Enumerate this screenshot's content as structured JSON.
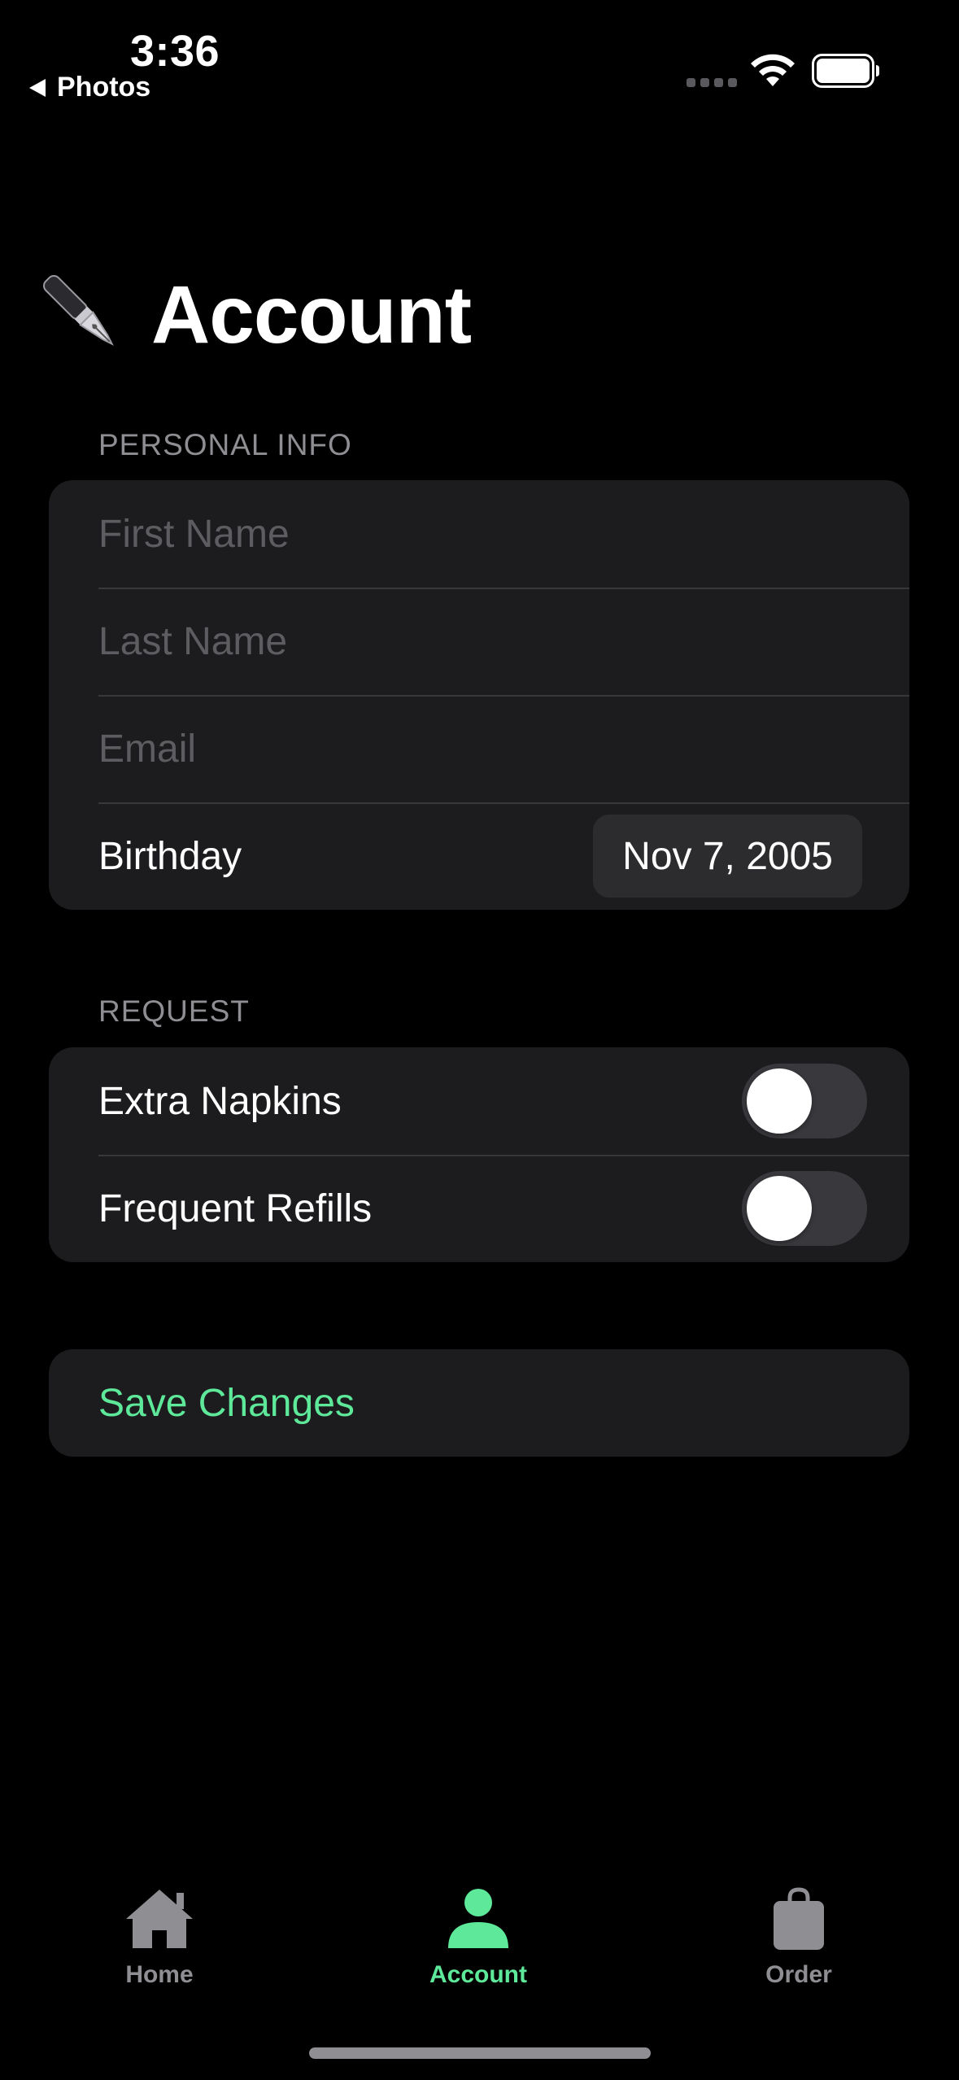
{
  "status_bar": {
    "time": "3:36",
    "back_label": "Photos"
  },
  "header": {
    "title": "Account",
    "icon": "fountain-pen-icon"
  },
  "personal_info": {
    "section_title": "PERSONAL INFO",
    "first_name_placeholder": "First Name",
    "last_name_placeholder": "Last Name",
    "email_placeholder": "Email",
    "birthday_label": "Birthday",
    "birthday_value": "Nov 7, 2005"
  },
  "request": {
    "section_title": "REQUEST",
    "items": [
      {
        "label": "Extra Napkins",
        "on": false
      },
      {
        "label": "Frequent Refills",
        "on": false
      }
    ]
  },
  "actions": {
    "save_label": "Save Changes"
  },
  "tab_bar": {
    "tabs": [
      {
        "label": "Home",
        "icon": "house-icon",
        "selected": false
      },
      {
        "label": "Account",
        "icon": "person-icon",
        "selected": true
      },
      {
        "label": "Order",
        "icon": "bag-icon",
        "selected": false
      }
    ]
  },
  "colors": {
    "accent": "#5ee89a",
    "background": "#000000",
    "cell_background": "#1c1c1e",
    "secondary_text": "#8e8e93"
  }
}
